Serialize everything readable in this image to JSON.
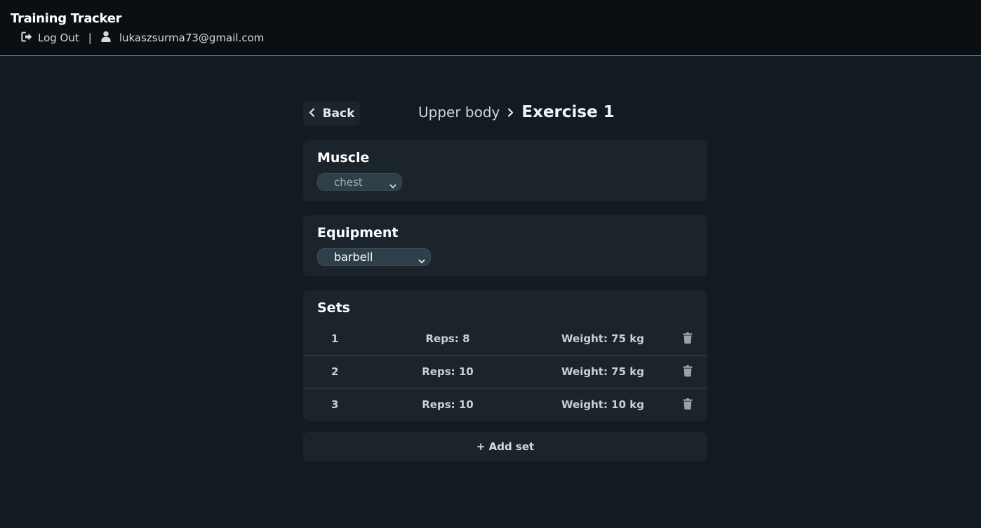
{
  "app": {
    "title": "Training Tracker"
  },
  "nav": {
    "logout_label": "Log Out",
    "separator": "|",
    "user_email": "lukaszsurma73@gmail.com"
  },
  "header": {
    "back_label": "Back",
    "breadcrumb_parent": "Upper body",
    "breadcrumb_current": "Exercise 1"
  },
  "muscle": {
    "title": "Muscle",
    "selected": "chest"
  },
  "equipment": {
    "title": "Equipment",
    "selected": "barbell"
  },
  "sets": {
    "title": "Sets",
    "rows": [
      {
        "num": "1",
        "reps": "Reps: 8",
        "weight": "Weight: 75 kg"
      },
      {
        "num": "2",
        "reps": "Reps: 10",
        "weight": "Weight: 75 kg"
      },
      {
        "num": "3",
        "reps": "Reps: 10",
        "weight": "Weight: 10 kg"
      }
    ]
  },
  "add_set_label": "+ Add set",
  "icons": {
    "logout": "logout-icon",
    "user": "user-icon",
    "back": "chevron-left-icon",
    "breadcrumb_sep": "chevron-right-icon",
    "select_caret": "chevron-down-icon",
    "delete": "trash-icon"
  },
  "colors": {
    "background": "#131a20",
    "navbar": "#0a0f13",
    "card": "#1b242b",
    "select": "#2f3f4a"
  }
}
